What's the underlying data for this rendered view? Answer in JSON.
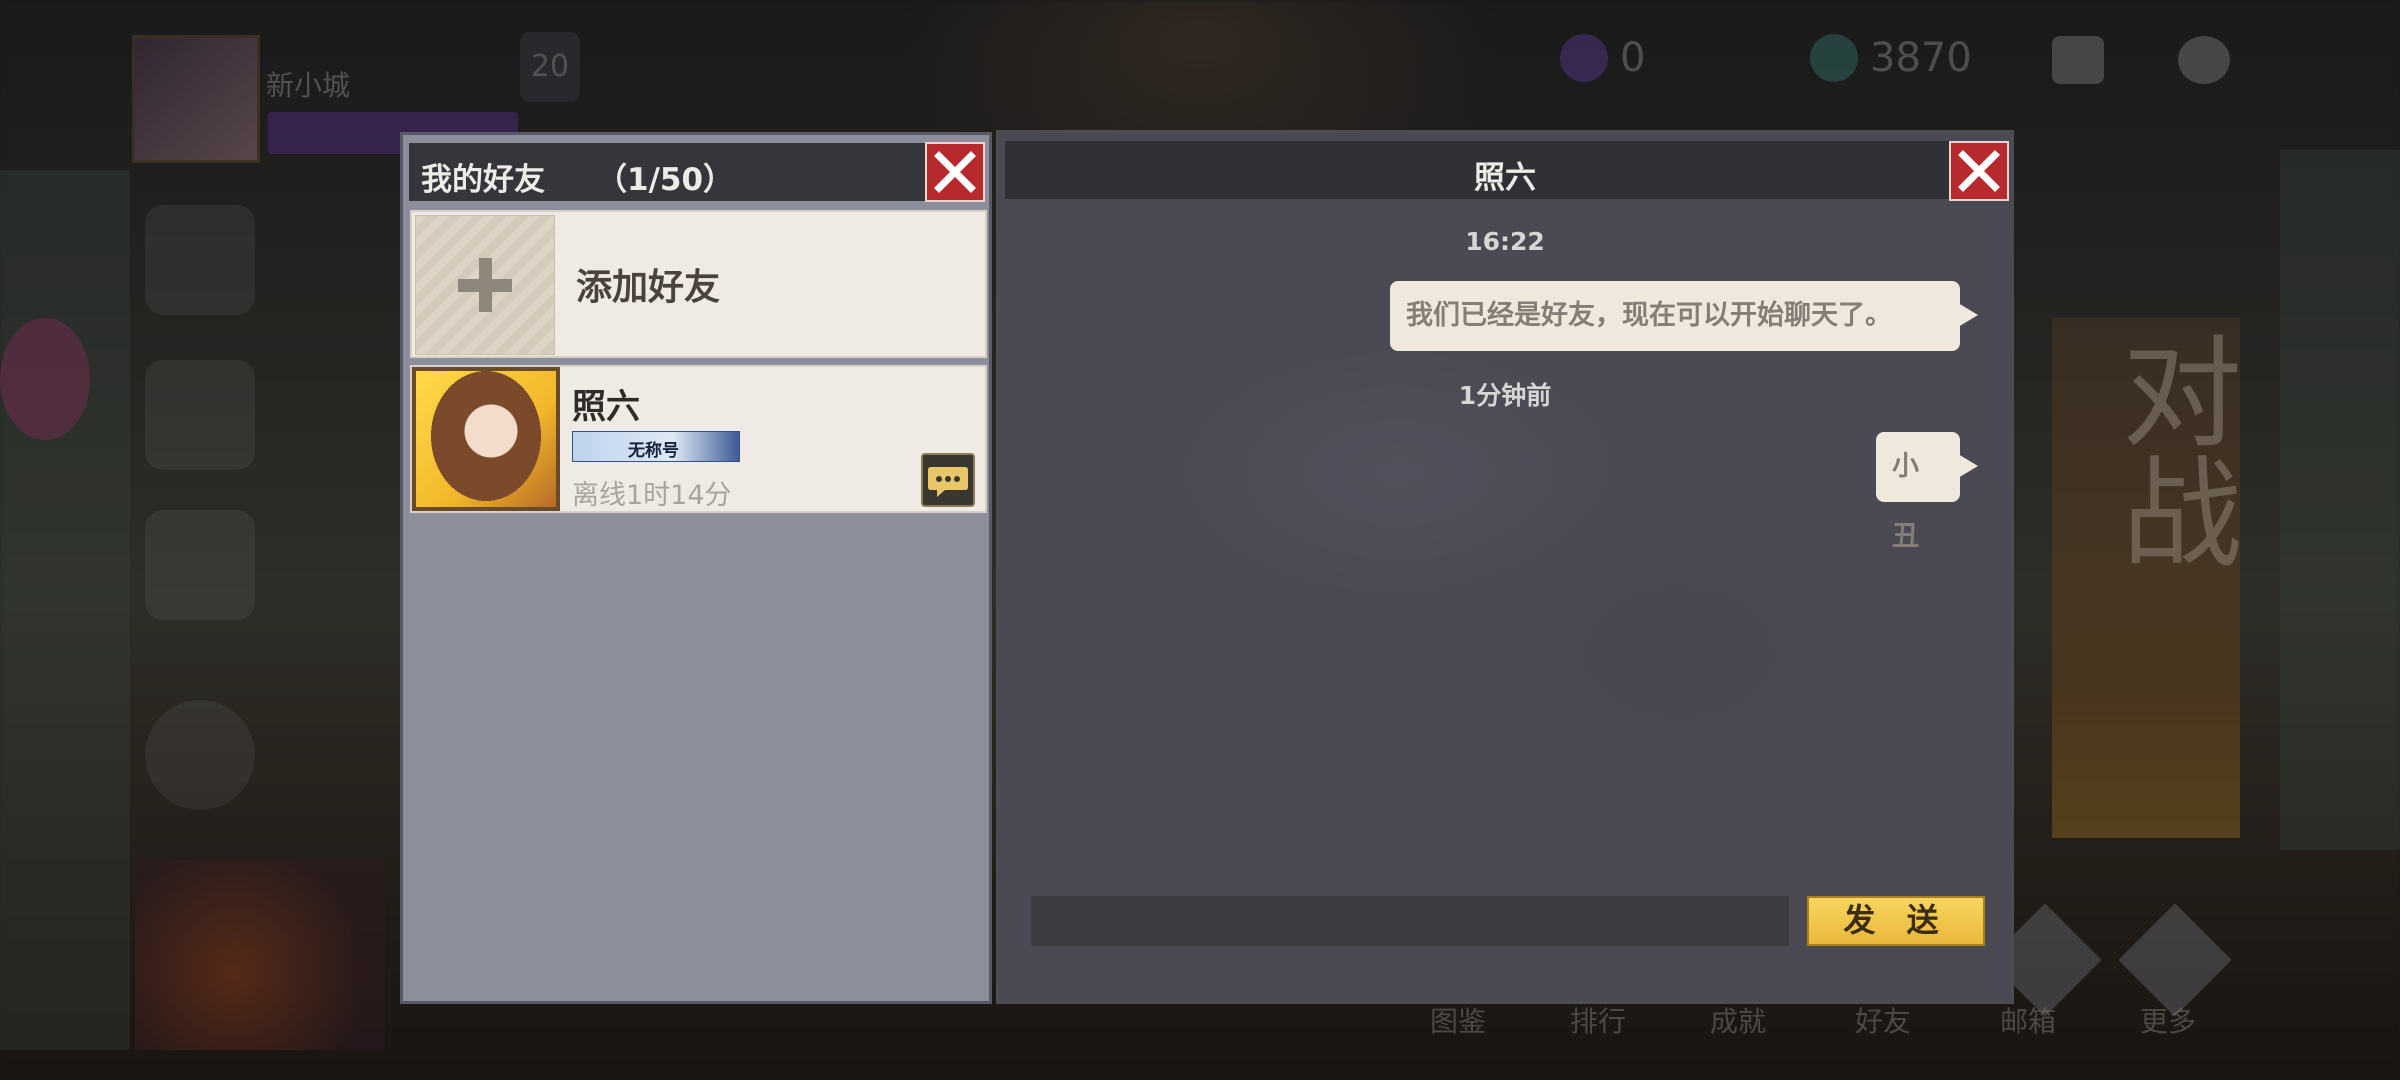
{
  "background": {
    "player_name": "新小城",
    "currency_purple": "0",
    "currency_jade": "3870",
    "banner_text": "对战",
    "bottom_nav": [
      "图鉴",
      "排行",
      "成就",
      "好友",
      "邮箱",
      "更多"
    ]
  },
  "friends_panel": {
    "title": "我的好友",
    "count": "（1/50）",
    "add_friend_label": "添加好友",
    "friends": [
      {
        "name": "照六",
        "title_badge": "无称号",
        "status": "离线1时14分"
      }
    ]
  },
  "chat_panel": {
    "title": "照六",
    "messages": [
      {
        "time": "16:22",
        "text": "我们已经是好友，现在可以开始聊天了。"
      },
      {
        "time": "1分钟前",
        "text": "小丑"
      }
    ],
    "input_value": "",
    "send_label": "发 送"
  },
  "colors": {
    "close_red": "#b6292c",
    "send_gold": "#f0c84b",
    "panel_gray": "#8d8e9c",
    "chat_bg": "#4b4a54"
  },
  "icons": [
    "close-icon",
    "plus-icon",
    "chat-bubble-icon"
  ]
}
